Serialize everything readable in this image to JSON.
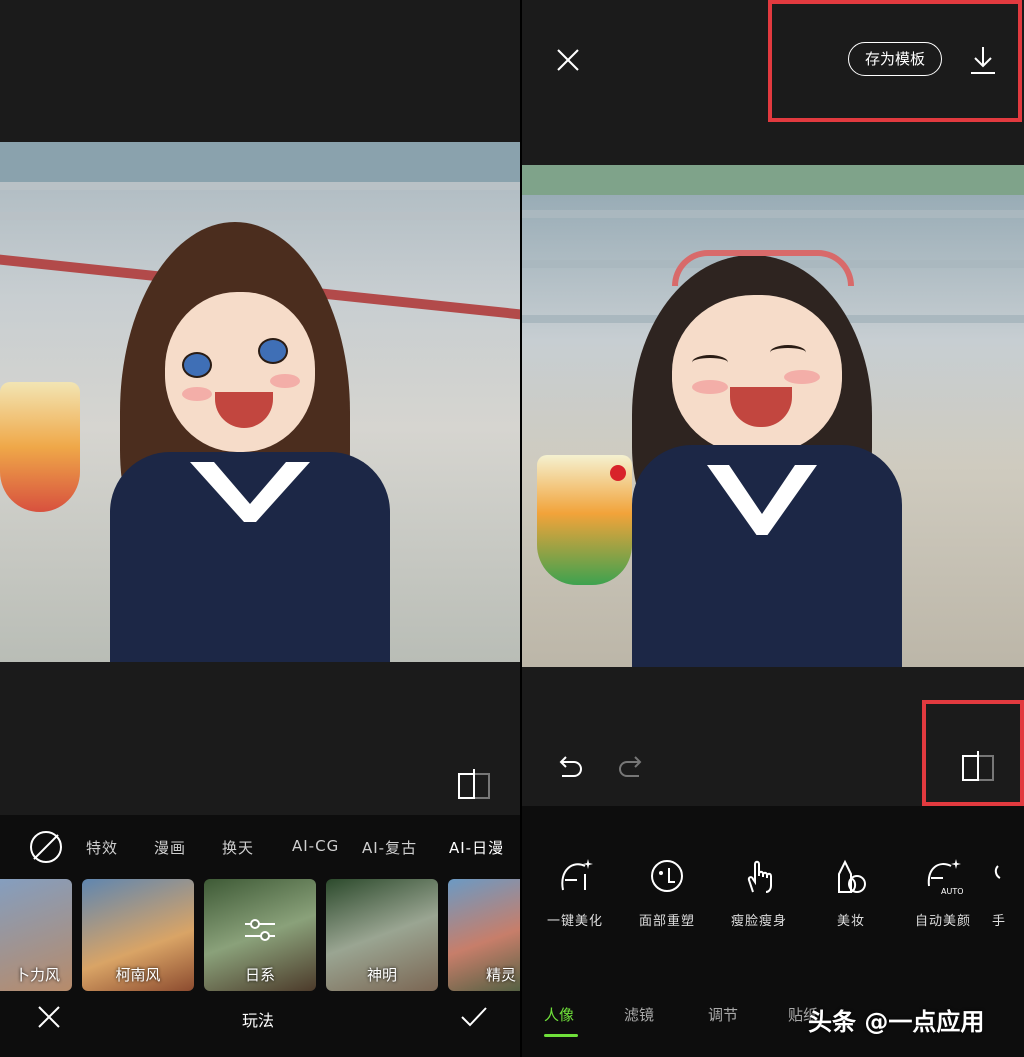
{
  "left": {
    "tabs": [
      {
        "label": "特效"
      },
      {
        "label": "漫画"
      },
      {
        "label": "换天"
      },
      {
        "label": "AI-CG"
      },
      {
        "label": "AI-复古"
      },
      {
        "label": "AI-日漫"
      }
    ],
    "thumbs": [
      {
        "label": "卜力风"
      },
      {
        "label": "柯南风"
      },
      {
        "label": "日系"
      },
      {
        "label": "神明"
      },
      {
        "label": "精灵"
      }
    ],
    "bottom_title": "玩法",
    "icons": {
      "close": "close-icon",
      "confirm": "check-icon",
      "none": "no-effect-icon",
      "compare": "compare-icon",
      "settings": "sliders-icon"
    }
  },
  "right": {
    "save_template_label": "存为模板",
    "tools": [
      {
        "label": "一键美化",
        "icon": "face-sparkle-icon"
      },
      {
        "label": "面部重塑",
        "icon": "face-reshape-icon"
      },
      {
        "label": "瘦脸瘦身",
        "icon": "hand-touch-icon"
      },
      {
        "label": "美妆",
        "icon": "makeup-icon"
      },
      {
        "label": "自动美颜",
        "icon": "auto-beauty-icon"
      },
      {
        "label": "手",
        "icon": "hand-icon"
      }
    ],
    "tabs": [
      {
        "label": "人像",
        "active": true
      },
      {
        "label": "滤镜",
        "active": false
      },
      {
        "label": "调节",
        "active": false
      },
      {
        "label": "贴纸",
        "active": false
      }
    ],
    "icons": {
      "close": "close-icon",
      "download": "download-icon",
      "undo": "undo-icon",
      "redo": "redo-icon",
      "compare": "compare-icon"
    }
  },
  "watermark": "头条 @一点应用",
  "colors": {
    "accent": "#6fe03a",
    "highlight": "#e23a3f",
    "background": "#1b1b1b"
  }
}
